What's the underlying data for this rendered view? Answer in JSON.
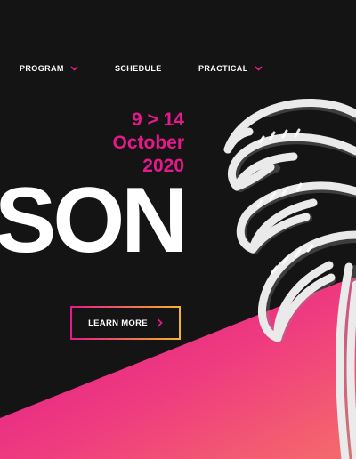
{
  "nav": {
    "items": [
      {
        "label": "PROGRAM",
        "has_dropdown": true
      },
      {
        "label": "SCHEDULE",
        "has_dropdown": false
      },
      {
        "label": "PRACTICAL",
        "has_dropdown": true
      }
    ]
  },
  "hero": {
    "date_line1": "9 > 14",
    "date_line2": "October",
    "date_line3": "2020",
    "headline": "SON",
    "cta_label": "LEARN MORE"
  },
  "colors": {
    "background": "#141414",
    "accent_pink": "#e5198a",
    "accent_orange": "#f5b52e",
    "text": "#ffffff"
  },
  "icons": [
    "chevron-down-icon",
    "chevron-right-icon",
    "palm-tree-illustration"
  ]
}
